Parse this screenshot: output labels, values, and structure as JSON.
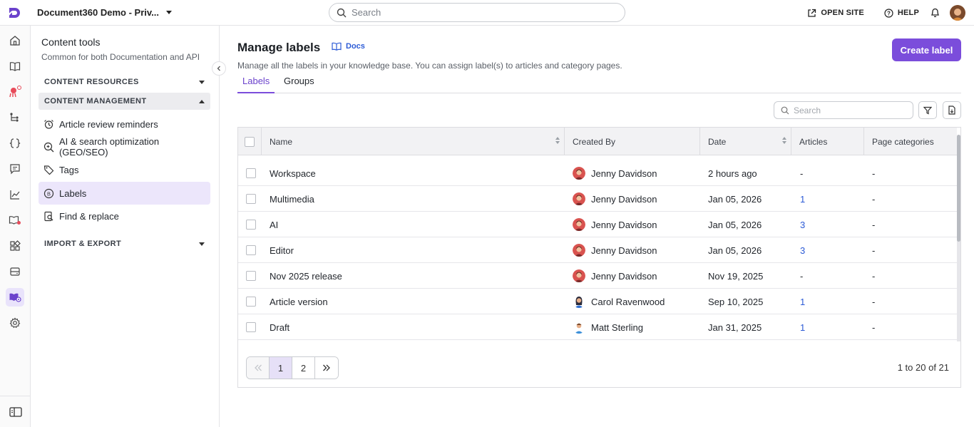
{
  "header": {
    "project_name": "Document360 Demo - Priv...",
    "search_placeholder": "Search",
    "open_site_label": "OPEN SITE",
    "help_label": "HELP"
  },
  "sidebar": {
    "title": "Content tools",
    "subtitle": "Common for both Documentation and API",
    "sections": {
      "content_resources": "CONTENT RESOURCES",
      "content_management": "CONTENT MANAGEMENT",
      "import_export": "IMPORT & EXPORT"
    },
    "items": [
      {
        "label": "Article review reminders",
        "icon": "alarm-clock-icon"
      },
      {
        "label": "AI & search optimization (GEO/SEO)",
        "icon": "search-sparkle-icon"
      },
      {
        "label": "Tags",
        "icon": "tag-icon"
      },
      {
        "label": "Labels",
        "icon": "label-icon",
        "active": true
      },
      {
        "label": "Find & replace",
        "icon": "find-replace-icon"
      }
    ]
  },
  "page": {
    "title": "Manage labels",
    "docs_label": "Docs",
    "description": "Manage all the labels in your knowledge base. You can assign label(s) to articles and category pages.",
    "create_button": "Create label",
    "tabs": [
      {
        "label": "Labels",
        "active": true
      },
      {
        "label": "Groups",
        "active": false
      }
    ],
    "table_search_placeholder": "Search"
  },
  "table": {
    "columns": {
      "name": "Name",
      "created_by": "Created By",
      "date": "Date",
      "articles": "Articles",
      "page_categories": "Page categories"
    },
    "rows": [
      {
        "name": "Workspace",
        "created_by": "Jenny Davidson",
        "date": "2 hours ago",
        "articles": "-",
        "page_categories": "-"
      },
      {
        "name": "Multimedia",
        "created_by": "Jenny Davidson",
        "date": "Jan 05, 2026",
        "articles": "1",
        "page_categories": "-"
      },
      {
        "name": "AI",
        "created_by": "Jenny Davidson",
        "date": "Jan 05, 2026",
        "articles": "3",
        "page_categories": "-"
      },
      {
        "name": "Editor",
        "created_by": "Jenny Davidson",
        "date": "Jan 05, 2026",
        "articles": "3",
        "page_categories": "-"
      },
      {
        "name": "Nov 2025 release",
        "created_by": "Jenny Davidson",
        "date": "Nov 19, 2025",
        "articles": "-",
        "page_categories": "-"
      },
      {
        "name": "Article version",
        "created_by": "Carol Ravenwood",
        "date": "Sep 10, 2025",
        "articles": "1",
        "page_categories": "-"
      },
      {
        "name": "Draft",
        "created_by": "Matt Sterling",
        "date": "Jan 31, 2025",
        "articles": "1",
        "page_categories": "-"
      }
    ]
  },
  "pagination": {
    "pages": [
      "1",
      "2"
    ],
    "current": "1",
    "summary": "1 to 20 of 21"
  },
  "colors": {
    "accent": "#7b4ddb",
    "link": "#2c5bd6"
  }
}
